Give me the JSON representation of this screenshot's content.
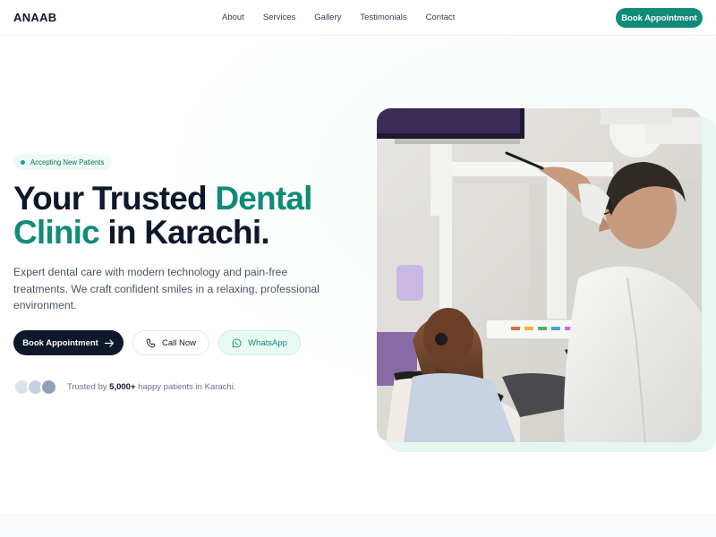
{
  "nav": {
    "logo": "ANAAB",
    "links": [
      "About",
      "Services",
      "Gallery",
      "Testimonials",
      "Contact"
    ],
    "cta": "Book Appointment"
  },
  "hero": {
    "badge": "Accepting New Patients",
    "headline_part1": "Your Trusted ",
    "headline_accent1": "Dental",
    "headline_accent2": "Clinic",
    "headline_part2": " in Karachi.",
    "subtext": "Expert dental care with modern technology and pain-free treatments. We craft confident smiles in a relaxing, professional environment.",
    "buttons": {
      "book": "Book Appointment",
      "call": "Call Now",
      "whatsapp": "WhatsApp"
    },
    "trust_prefix": "Trusted by ",
    "trust_count": "5,000+",
    "trust_suffix": " happy patients in Karachi."
  },
  "colors": {
    "brand": "#0f8b78",
    "dark": "#0f172a",
    "badge_bg": "#eefaf6"
  },
  "icons": {
    "arrow": "arrow-right-icon",
    "phone": "phone-icon",
    "whatsapp": "whatsapp-icon"
  }
}
